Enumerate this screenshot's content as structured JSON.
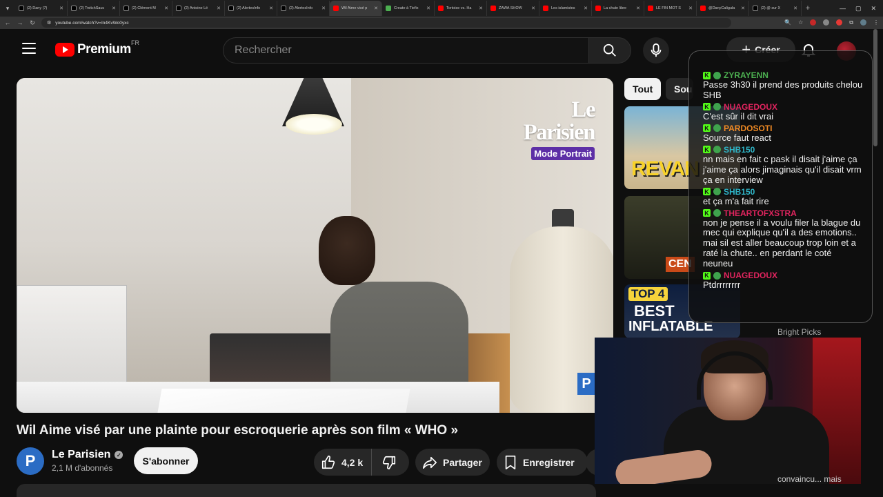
{
  "browser": {
    "tabs": [
      {
        "title": "(2) Dany (7)",
        "favicon": "x"
      },
      {
        "title": "(2) TwitchSauc",
        "favicon": "x"
      },
      {
        "title": "(2) Clément M",
        "favicon": "x"
      },
      {
        "title": "(2) Antoine Lé",
        "favicon": "x"
      },
      {
        "title": "(2) AlertesInfo",
        "favicon": "x"
      },
      {
        "title": "(2) AlertesInfo",
        "favicon": "x"
      },
      {
        "title": "Wil Aime visé p",
        "favicon": "yt",
        "active": true
      },
      {
        "title": "Create à Tiefix",
        "favicon": "g"
      },
      {
        "title": "Tortoise vs. Ha",
        "favicon": "yt"
      },
      {
        "title": "ZAWA SHOW",
        "favicon": "yt"
      },
      {
        "title": "Les islamistes",
        "favicon": "yt"
      },
      {
        "title": "La chute libre",
        "favicon": "yt"
      },
      {
        "title": "LE FIN MOT S",
        "favicon": "yt"
      },
      {
        "title": "@DanyCaligula",
        "favicon": "yt"
      },
      {
        "title": "(2) @ sur X",
        "favicon": "x"
      }
    ],
    "url": "youtube.com/watch?v=In4KvWo0yxc"
  },
  "masthead": {
    "brand": "Premium",
    "country": "FR",
    "search_placeholder": "Rechercher",
    "create_label": "Créer"
  },
  "video": {
    "title": "Wil Aime visé par une plainte pour escroquerie après son film « WHO »",
    "watermark_title": "Le Parisien",
    "watermark_badge": "Mode Portrait"
  },
  "channel": {
    "avatar_letter": "P",
    "name": "Le Parisien",
    "subscribers": "2,1 M d'abonnés",
    "subscribe_label": "S'abonner"
  },
  "actions": {
    "likes": "4,2 k",
    "share_label": "Partager",
    "save_label": "Enregistrer"
  },
  "sidebar": {
    "chips": [
      "Tout",
      "Sou"
    ],
    "recommended": [
      {
        "thumb_text": "REVAN"
      },
      {
        "thumb_text": "CEN"
      },
      {
        "thumb_line1": "TOP 4",
        "thumb_line2": "BEST",
        "thumb_line3": "INFLATABLE",
        "ad_label": "Bright Picks"
      }
    ]
  },
  "chat": {
    "messages": [
      {
        "user": "ZYRAYENN",
        "color": "#4caf50",
        "text": "Passe 3h30 il prend des produits chelou SHB"
      },
      {
        "user": "NUAGEDOUX",
        "color": "#e0245e",
        "text": "C'est sûr il dit vrai"
      },
      {
        "user": "PARDOSOTI",
        "color": "#f08a24",
        "text": "Source faut react"
      },
      {
        "user": "SHB150",
        "color": "#2fb5c7",
        "text": "nn mais en fait c pask il disait j'aime ça j'aime ça alors jimaginais qu'il disait vrm ça en interview"
      },
      {
        "user": "SHB150",
        "color": "#2fb5c7",
        "text": "et ça m'a fait rire"
      },
      {
        "user": "THEARTOFXSTRA",
        "color": "#e0245e",
        "text": "non je pense il a voulu filer la blague du mec qui explique qu'il a des emotions.. mai sil est aller beaucoup trop loin et a raté la chute.. en perdant le coté neuneu"
      },
      {
        "user": "NUAGEDOUX",
        "color": "#e0245e",
        "text": "Ptdrrrrrrrr"
      }
    ]
  },
  "webcam": {
    "caption": "convaincu... mais"
  },
  "colors": {
    "accent": "#ff0000",
    "kick_green": "#53fc18",
    "background": "#0f0f0f"
  }
}
